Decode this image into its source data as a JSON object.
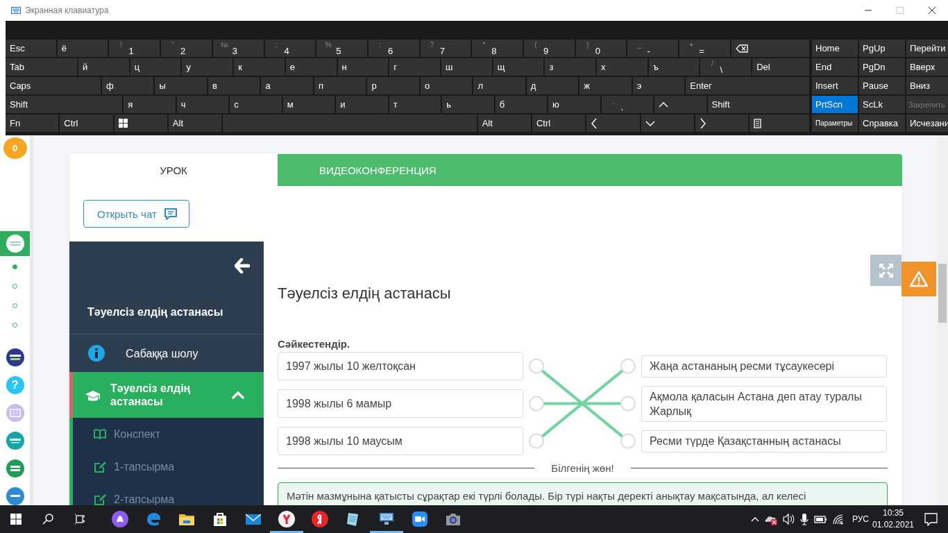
{
  "keyboard_window": {
    "title": "Экранная клавиатура",
    "rows": [
      [
        {
          "kind": "text",
          "label": "Esc"
        },
        {
          "kind": "text",
          "label": "ё"
        },
        {
          "kind": "text",
          "label": "1",
          "shift": "!"
        },
        {
          "kind": "text",
          "label": "2",
          "shift": "\""
        },
        {
          "kind": "text",
          "label": "3",
          "shift": "№"
        },
        {
          "kind": "text",
          "label": "4",
          "shift": ";"
        },
        {
          "kind": "text",
          "label": "5",
          "shift": "%"
        },
        {
          "kind": "text",
          "label": "6",
          "shift": ":"
        },
        {
          "kind": "text",
          "label": "7",
          "shift": "?"
        },
        {
          "kind": "text",
          "label": "8",
          "shift": "*"
        },
        {
          "kind": "text",
          "label": "9",
          "shift": "("
        },
        {
          "kind": "text",
          "label": "0",
          "shift": ")"
        },
        {
          "kind": "text",
          "label": "-",
          "shift": "_"
        },
        {
          "kind": "text",
          "label": "=",
          "shift": "+"
        },
        {
          "kind": "backspace"
        }
      ],
      [
        {
          "kind": "text",
          "label": "Tab"
        },
        {
          "kind": "text",
          "label": "й"
        },
        {
          "kind": "text",
          "label": "ц"
        },
        {
          "kind": "text",
          "label": "у"
        },
        {
          "kind": "text",
          "label": "к"
        },
        {
          "kind": "text",
          "label": "е"
        },
        {
          "kind": "text",
          "label": "н"
        },
        {
          "kind": "text",
          "label": "г"
        },
        {
          "kind": "text",
          "label": "ш"
        },
        {
          "kind": "text",
          "label": "щ"
        },
        {
          "kind": "text",
          "label": "з"
        },
        {
          "kind": "text",
          "label": "х"
        },
        {
          "kind": "text",
          "label": "ъ"
        },
        {
          "kind": "text",
          "label": "\\",
          "shift": "/"
        },
        {
          "kind": "text",
          "label": "Del"
        }
      ],
      [
        {
          "kind": "text",
          "label": "Caps"
        },
        {
          "kind": "text",
          "label": "ф"
        },
        {
          "kind": "text",
          "label": "ы"
        },
        {
          "kind": "text",
          "label": "в"
        },
        {
          "kind": "text",
          "label": "а"
        },
        {
          "kind": "text",
          "label": "п"
        },
        {
          "kind": "text",
          "label": "р"
        },
        {
          "kind": "text",
          "label": "о"
        },
        {
          "kind": "text",
          "label": "л"
        },
        {
          "kind": "text",
          "label": "д"
        },
        {
          "kind": "text",
          "label": "ж"
        },
        {
          "kind": "text",
          "label": "э"
        },
        {
          "kind": "text",
          "label": "Enter"
        }
      ],
      [
        {
          "kind": "text",
          "label": "Shift"
        },
        {
          "kind": "text",
          "label": "я"
        },
        {
          "kind": "text",
          "label": "ч"
        },
        {
          "kind": "text",
          "label": "с"
        },
        {
          "kind": "text",
          "label": "м"
        },
        {
          "kind": "text",
          "label": "и"
        },
        {
          "kind": "text",
          "label": "т"
        },
        {
          "kind": "text",
          "label": "ь"
        },
        {
          "kind": "text",
          "label": "б"
        },
        {
          "kind": "text",
          "label": "ю"
        },
        {
          "kind": "text",
          "label": ".",
          "shift": ","
        },
        {
          "kind": "up"
        },
        {
          "kind": "text",
          "label": "Shift"
        }
      ],
      [
        {
          "kind": "text",
          "label": "Fn"
        },
        {
          "kind": "text",
          "label": "Ctrl"
        },
        {
          "kind": "windows"
        },
        {
          "kind": "text",
          "label": "Alt"
        },
        {
          "kind": "space"
        },
        {
          "kind": "text",
          "label": "Alt"
        },
        {
          "kind": "text",
          "label": "Ctrl"
        },
        {
          "kind": "left"
        },
        {
          "kind": "down"
        },
        {
          "kind": "right"
        },
        {
          "kind": "menu"
        }
      ]
    ],
    "nav_keys": [
      {
        "kind": "text",
        "label": "Home",
        "on": false,
        "disabled": false
      },
      {
        "kind": "text",
        "label": "PgUp",
        "on": false,
        "disabled": false
      },
      {
        "kind": "text",
        "label": "Перейти",
        "on": false,
        "disabled": false
      },
      {
        "kind": "text",
        "label": "End",
        "on": false,
        "disabled": false
      },
      {
        "kind": "text",
        "label": "PgDn",
        "on": false,
        "disabled": false
      },
      {
        "kind": "text",
        "label": "Вверх",
        "on": false,
        "disabled": false
      },
      {
        "kind": "text",
        "label": "Insert",
        "on": false,
        "disabled": false
      },
      {
        "kind": "text",
        "label": "Pause",
        "on": false,
        "disabled": false
      },
      {
        "kind": "text",
        "label": "Вниз",
        "on": false,
        "disabled": false
      },
      {
        "kind": "text",
        "label": "PrtScn",
        "on": true,
        "disabled": false
      },
      {
        "kind": "text",
        "label": "ScLk",
        "on": false,
        "disabled": false
      },
      {
        "kind": "text",
        "label": "Закрепить",
        "on": false,
        "disabled": true
      },
      {
        "kind": "small",
        "label": "Параметры",
        "on": false,
        "disabled": false
      },
      {
        "kind": "text",
        "label": "Справка",
        "on": false,
        "disabled": false
      },
      {
        "kind": "text",
        "label": "Исчезани",
        "on": false,
        "disabled": false
      }
    ]
  },
  "left_rail": {
    "badge": "0",
    "help_label": "?",
    "pager": [
      {
        "selected": true
      },
      {
        "selected": false
      },
      {
        "selected": false
      },
      {
        "selected": false
      }
    ]
  },
  "tabs": [
    {
      "label": "УРОК",
      "selected": true
    },
    {
      "label": "ВИДЕОКОНФЕРЕНЦИЯ",
      "selected": false
    }
  ],
  "chat_button": "Открыть чат",
  "lesson_nav": {
    "title": "Тәуелсіз елдің астанасы",
    "items": [
      {
        "kind": "info",
        "label": "Сабаққа шолу",
        "selected": false
      },
      {
        "kind": "section",
        "label": "Тәуелсіз елдің астанасы",
        "selected": true,
        "expanded": true,
        "children": [
          {
            "kind": "book",
            "label": "Конспект"
          },
          {
            "kind": "edit",
            "label": "1-тапсырма"
          },
          {
            "kind": "edit",
            "label": "2-тапсырма"
          }
        ]
      }
    ]
  },
  "content": {
    "heading": "Тәуелсіз елдің астанасы",
    "instruction": "Сәйкестендір.",
    "left_items": [
      "1997 жылы 10 желтоқсан",
      "1998 жылы 6 мамыр",
      "1998 жылы 10 маусым"
    ],
    "right_items": [
      "Жаңа астананың ресми тұсаукесері",
      "Ақмола қаласын Астана деп атау туралы Жарлық",
      "Ресми түрде Қазақстанның астанасы"
    ],
    "divider_label": "Білгенің жөн!",
    "note": "Мәтін мазмұнына қатысты сұрақтар екі түрлі болады. Бір түрі нақты деректі анықтау мақсатында, ал келесі"
  },
  "taskbar": {
    "apps": [
      {
        "kind": "alice",
        "running": false
      },
      {
        "kind": "edge",
        "running": false
      },
      {
        "kind": "explorer",
        "running": false
      },
      {
        "kind": "store",
        "running": false
      },
      {
        "kind": "mail",
        "running": false
      },
      {
        "kind": "yandex-browser",
        "running": true
      },
      {
        "kind": "yandex",
        "running": false
      },
      {
        "kind": "notepad",
        "running": false
      },
      {
        "kind": "keyboard",
        "running": true
      },
      {
        "kind": "zoom",
        "running": false
      },
      {
        "kind": "camera",
        "running": false
      }
    ],
    "language": "РУС",
    "time": "10:35",
    "date": "01.02.2021"
  }
}
